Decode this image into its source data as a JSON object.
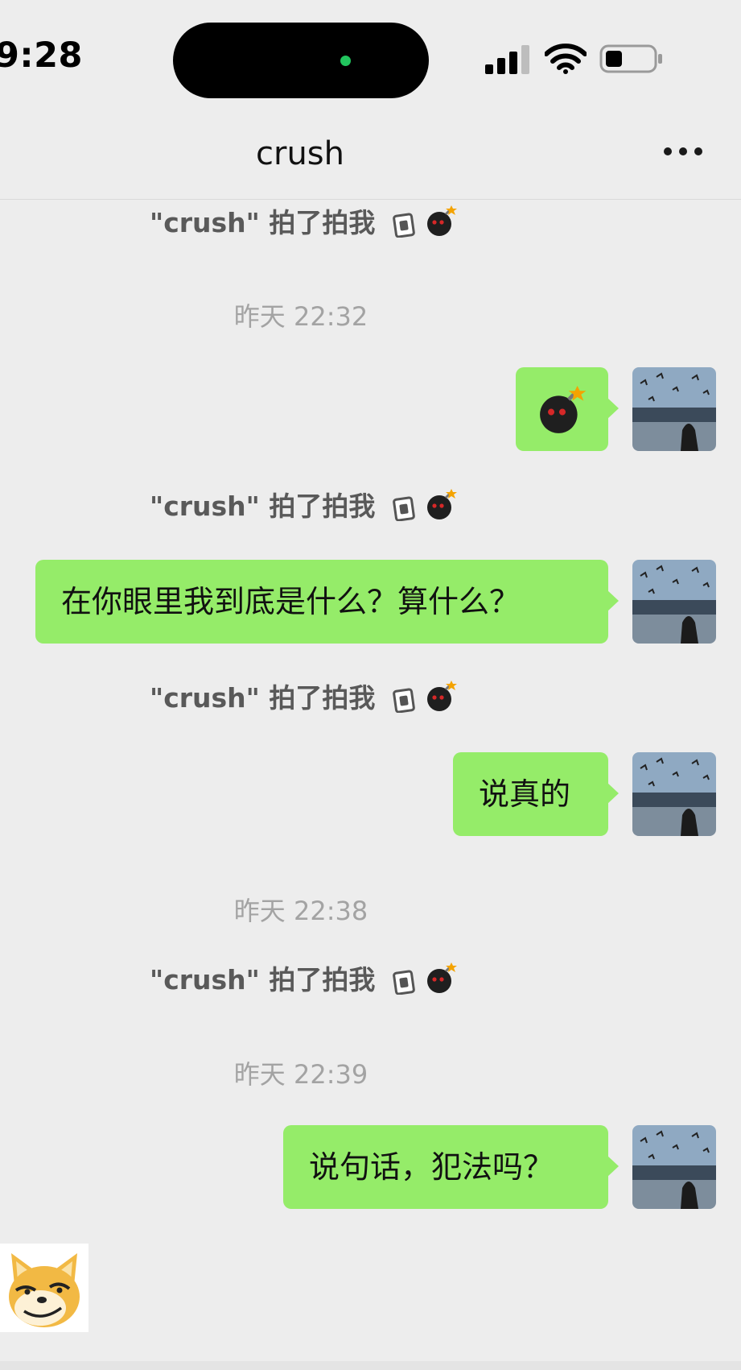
{
  "status_bar": {
    "time": "9:28"
  },
  "nav": {
    "title": "crush",
    "more_icon": "more-dots-icon"
  },
  "messages": [
    {
      "type": "pat",
      "text": "\"crush\" 拍了拍我"
    },
    {
      "type": "timestamp",
      "text": "昨天 22:32"
    },
    {
      "type": "sent",
      "emoji": "bomb-emoji"
    },
    {
      "type": "pat",
      "text": "\"crush\" 拍了拍我"
    },
    {
      "type": "sent",
      "text": "在你眼里我到底是什么？算什么？"
    },
    {
      "type": "pat",
      "text": "\"crush\" 拍了拍我"
    },
    {
      "type": "sent",
      "text": "说真的"
    },
    {
      "type": "timestamp",
      "text": "昨天 22:38"
    },
    {
      "type": "pat",
      "text": "\"crush\" 拍了拍我"
    },
    {
      "type": "timestamp",
      "text": "昨天 22:39"
    },
    {
      "type": "sent",
      "text": "说句话，犯法吗？"
    },
    {
      "type": "received_sticker",
      "sticker": "doge-sticker"
    }
  ],
  "colors": {
    "background": "#ededed",
    "sent_bubble": "#95ec69",
    "timestamp_text": "#a3a3a3",
    "pat_text": "#595959",
    "island_dot": "#22c55e"
  }
}
